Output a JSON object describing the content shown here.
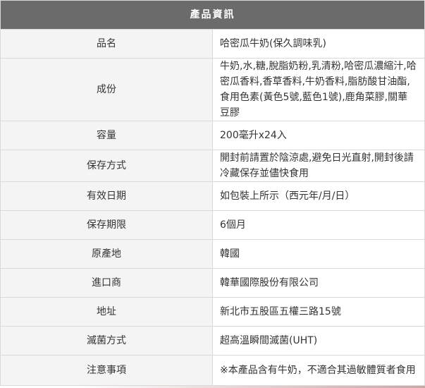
{
  "table": {
    "title": "產品資訊",
    "rows": [
      {
        "label": "品名",
        "value": "哈密瓜牛奶(保久調味乳)"
      },
      {
        "label": "成份",
        "value": "牛奶,水,糖,脫脂奶粉,乳清粉,哈密瓜濃縮汁,哈密瓜香料,香草香料,牛奶香料,脂肪酸甘油酯,食用色素(黃色5號,藍色1號),鹿角菜膠,關華豆膠"
      },
      {
        "label": "容量",
        "value": "200毫升x24入"
      },
      {
        "label": "保存方式",
        "value": "開封前請置於陰涼處,避免日光直射,開封後請冷藏保存並儘快食用"
      },
      {
        "label": "有效日期",
        "value": "如包裝上所示（西元年/月/日）"
      },
      {
        "label": "保存期限",
        "value": "6個月"
      },
      {
        "label": "原產地",
        "value": "韓國"
      },
      {
        "label": "進口商",
        "value": "韓華國際股份有限公司"
      },
      {
        "label": "地址",
        "value": "新北市五股區五權三路15號"
      },
      {
        "label": "滅菌方式",
        "value": "超高溫瞬間滅菌(UHT)"
      },
      {
        "label": "注意事項",
        "value": "※本產品含有牛奶，不適合其過敏體質者食用"
      }
    ]
  },
  "colors": {
    "header_bg": "#6b6b6b",
    "label_bg": "#f4f4f4",
    "border": "#d9d9d9"
  }
}
